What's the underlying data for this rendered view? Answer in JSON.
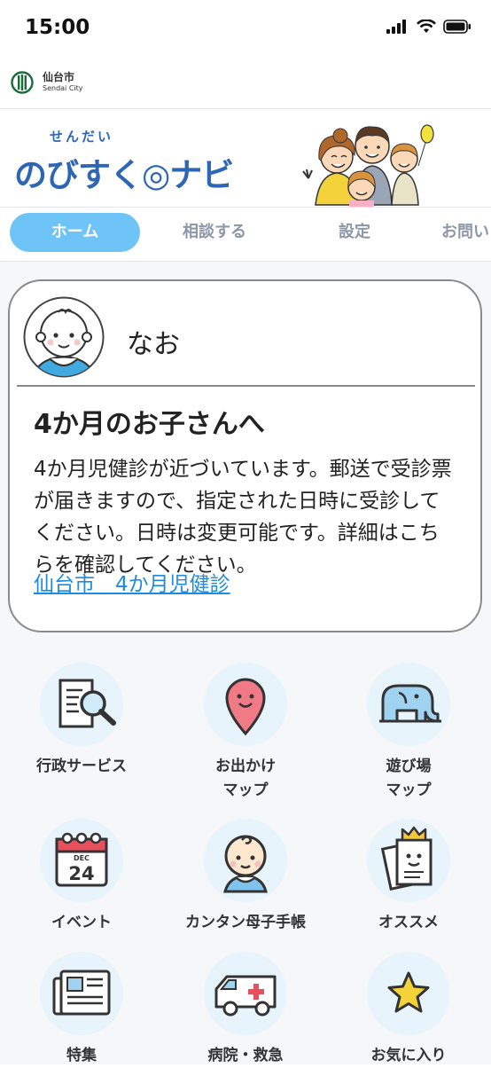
{
  "status_bar": {
    "time": "15:00"
  },
  "city_bar": {
    "name": "仙台市",
    "name_en": "Sendai City"
  },
  "brand": {
    "kana": "せんだい",
    "logo_text": "のびすく◎ナビ"
  },
  "tabs": [
    {
      "label": "ホーム",
      "active": true
    },
    {
      "label": "相談する",
      "active": false
    },
    {
      "label": "設定",
      "active": false
    },
    {
      "label": "お問い",
      "active": false
    }
  ],
  "profile_card": {
    "user_name": "なお",
    "title": "4か月のお子さんへ",
    "body": "4か月児健診が近づいています。郵送で受診票が届きますので、指定された日時に受診してください。日時は変更可能です。詳細はこちらを確認してください。",
    "link_text": "仙台市　4か月児健診"
  },
  "menu": [
    {
      "label": "行政サービス",
      "icon": "document-search-icon"
    },
    {
      "label": "お出かけ\nマップ",
      "icon": "map-pin-icon"
    },
    {
      "label": "遊び場\nマップ",
      "icon": "elephant-slide-icon"
    },
    {
      "label": "イベント",
      "icon": "calendar-icon",
      "calendar_month": "DEC",
      "calendar_day": "24"
    },
    {
      "label": "カンタン母子手帳",
      "icon": "baby-icon"
    },
    {
      "label": "オススメ",
      "icon": "crown-paper-icon"
    },
    {
      "label": "特集",
      "icon": "newspaper-icon"
    },
    {
      "label": "病院・救急",
      "icon": "ambulance-icon"
    },
    {
      "label": "お気に入り",
      "icon": "star-icon"
    }
  ],
  "colors": {
    "accent": "#6ec4f6",
    "brand_blue": "#2d66b4",
    "link": "#1e8be0",
    "icon_bg": "#e7f4fc"
  }
}
